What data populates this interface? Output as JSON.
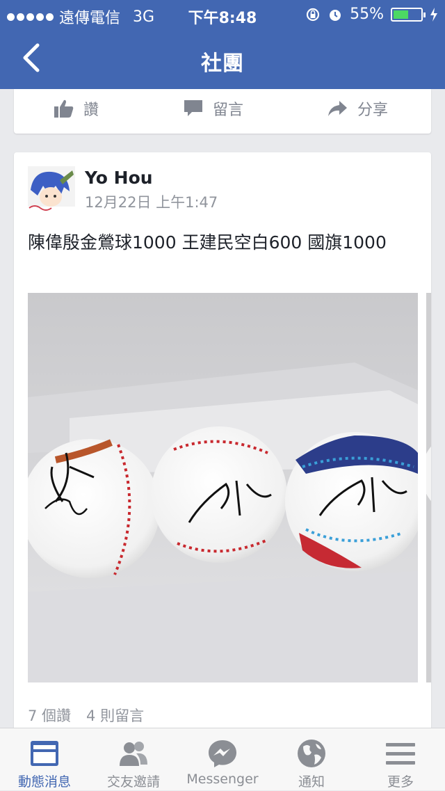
{
  "status_bar": {
    "carrier": "遠傳電信",
    "network": "3G",
    "time": "下午8:48",
    "battery": "55%",
    "battery_level": 0.55
  },
  "nav": {
    "title": "社團"
  },
  "previous_post": {
    "actions": [
      {
        "label": "讚",
        "icon": "like-icon"
      },
      {
        "label": "留言",
        "icon": "comment-icon"
      },
      {
        "label": "分享",
        "icon": "share-icon"
      }
    ]
  },
  "post": {
    "author": "Yo Hou",
    "timestamp": "12月22日 上午1:47",
    "text": "陳偉殷金鶯球1000  王建民空白600  國旗1000",
    "likes": "7 個讚",
    "comments": "4 則留言"
  },
  "tab_bar": {
    "items": [
      {
        "label": "動態消息",
        "icon": "news-feed-icon",
        "active": true
      },
      {
        "label": "交友邀請",
        "icon": "friend-requests-icon",
        "active": false
      },
      {
        "label": "Messenger",
        "icon": "messenger-icon",
        "active": false
      },
      {
        "label": "通知",
        "icon": "globe-icon",
        "active": false
      },
      {
        "label": "更多",
        "icon": "menu-icon",
        "active": false
      }
    ]
  },
  "colors": {
    "brand": "#4267b2",
    "battery": "#4cd964"
  }
}
